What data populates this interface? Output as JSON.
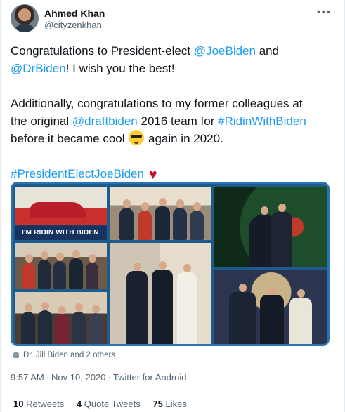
{
  "author": {
    "name": "Ahmed Khan",
    "handle": "@cityzenkhan",
    "more_label": "•••"
  },
  "tweet": {
    "line1_prefix": "Congratulations to President-elect ",
    "line1_link": "@JoeBiden",
    "line1_suffix": " and",
    "line2_link": "@DrBiden",
    "line2_suffix": "! I wish you the best!",
    "line3": "Additionally, congratulations to my former colleagues at",
    "line4_prefix": "the original ",
    "line4_link1": "@draftbiden",
    "line4_mid": " 2016 team for ",
    "line4_link2": "#RidinWithBiden",
    "line5_prefix": "before it became cool ",
    "line5_suffix": " again in 2020.",
    "hashtag": "#PresidentElectJoeBiden",
    "emoji_sunglasses": "sunglasses-emoji",
    "emoji_heart": "♥"
  },
  "media": {
    "banner_text": "I'M RIDIN WITH BIDEN"
  },
  "tagged": {
    "label": "Dr. Jill Biden and 2 others"
  },
  "timestamp": {
    "time": "9:57 AM",
    "date": "Nov 10, 2020",
    "source": "Twitter for Android",
    "separator": "·"
  },
  "stats": {
    "retweets_count": "10",
    "retweets_label": "Retweets",
    "quotes_count": "4",
    "quotes_label": "Quote Tweets",
    "likes_count": "75",
    "likes_label": "Likes"
  },
  "colors": {
    "link": "#1d9bf0",
    "heart": "#c4122f",
    "secondary_text": "#536471"
  }
}
